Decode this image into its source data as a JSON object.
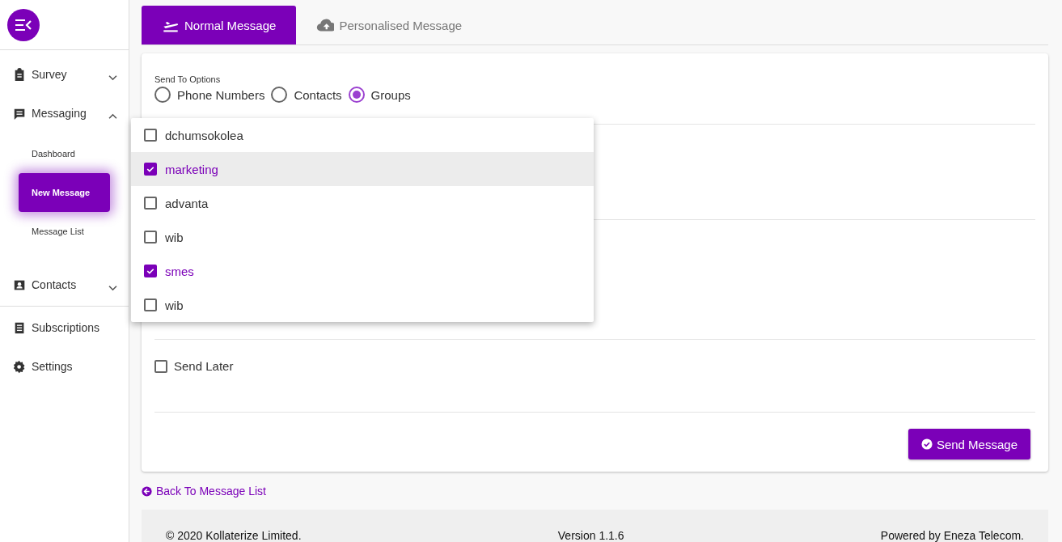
{
  "sidebar": {
    "items": [
      {
        "kind": "group",
        "label": "Survey",
        "expanded": false
      },
      {
        "kind": "group",
        "label": "Messaging",
        "expanded": true,
        "children": [
          {
            "label": "Dashboard",
            "selected": false
          },
          {
            "label": "New Message",
            "selected": true
          },
          {
            "label": "Message List",
            "selected": false
          }
        ]
      },
      {
        "kind": "group",
        "label": "Contacts",
        "expanded": false
      },
      {
        "kind": "link",
        "label": "Subscriptions"
      },
      {
        "kind": "link",
        "label": "Settings"
      }
    ]
  },
  "tabs": [
    {
      "label": "Normal Message",
      "selected": true
    },
    {
      "label": "Personalised Message",
      "selected": false
    }
  ],
  "send_to": {
    "label": "Send To Options",
    "options": [
      {
        "label": "Phone Numbers",
        "selected": false
      },
      {
        "label": "Contacts",
        "selected": false
      },
      {
        "label": "Groups",
        "selected": true
      }
    ]
  },
  "groups_dropdown": [
    {
      "label": "dchumsokolea",
      "checked": false,
      "highlighted": false
    },
    {
      "label": "marketing",
      "checked": true,
      "highlighted": true
    },
    {
      "label": "advanta",
      "checked": false,
      "highlighted": false
    },
    {
      "label": "wib",
      "checked": false,
      "highlighted": false
    },
    {
      "label": "smes",
      "checked": true,
      "highlighted": false
    },
    {
      "label": "wib",
      "checked": false,
      "highlighted": false
    }
  ],
  "send_later": {
    "label": "Send Later",
    "checked": false
  },
  "send_button": "Send Message",
  "back_link": "Back To Message List",
  "footer": {
    "copyright": "© 2020 Kollaterize Limited.",
    "version": "Version 1.1.6",
    "powered_by": "Powered by Eneza Telecom."
  }
}
